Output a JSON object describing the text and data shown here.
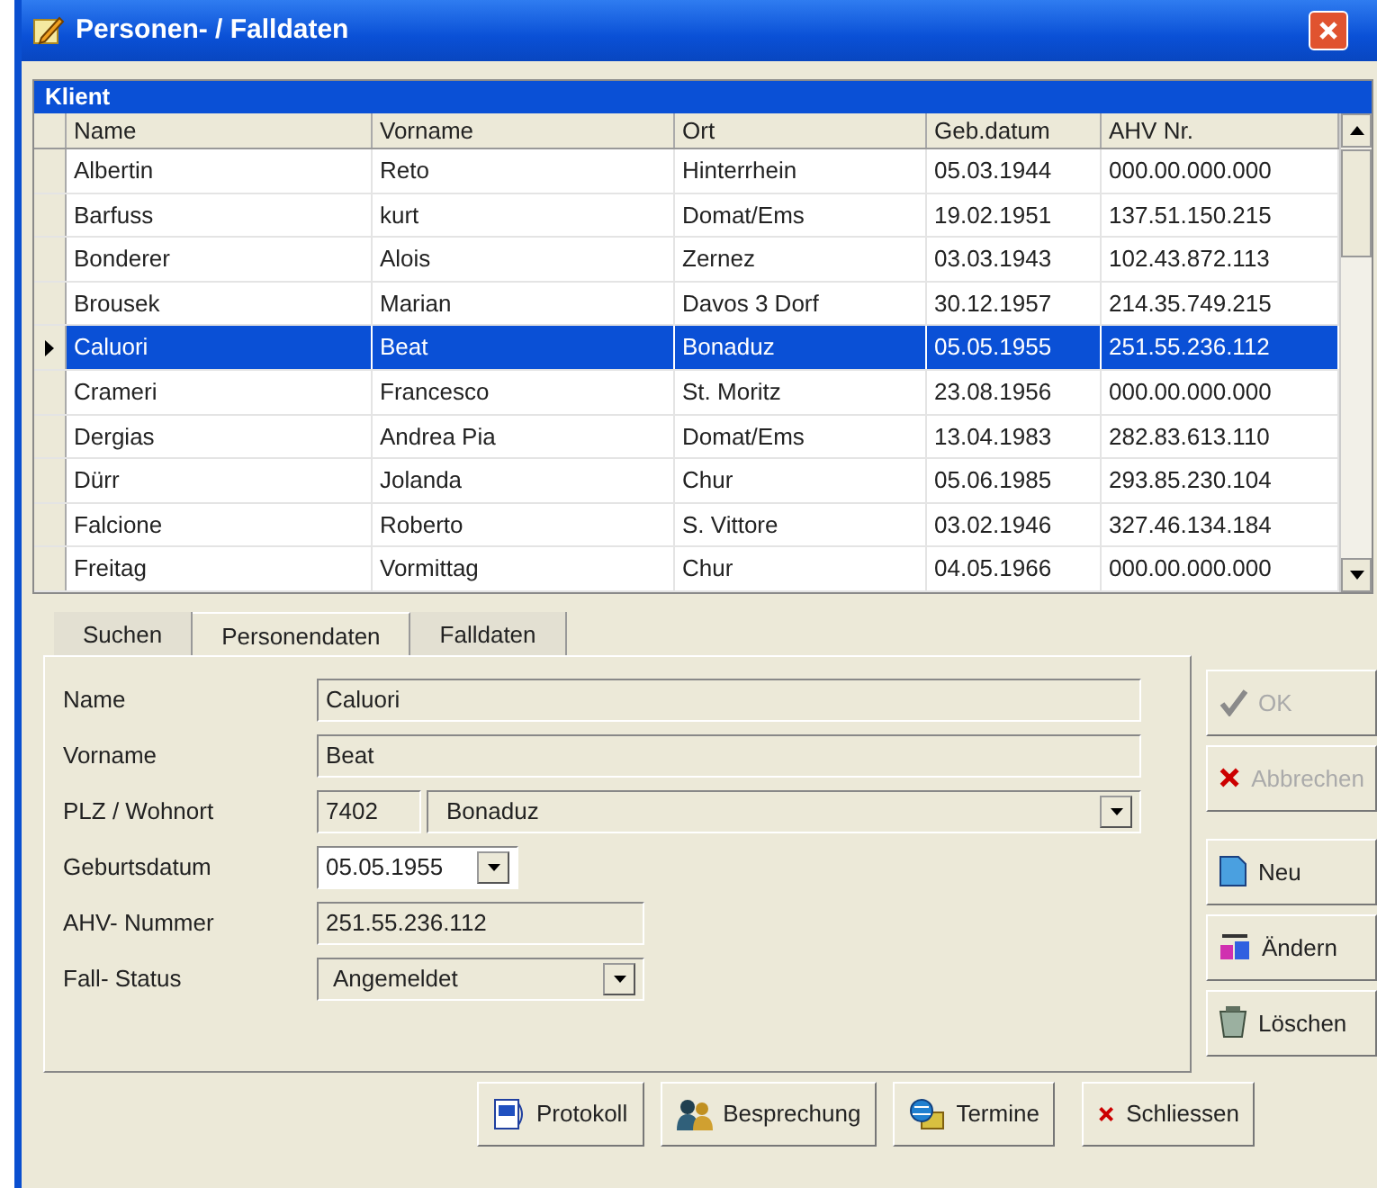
{
  "window": {
    "title": "Personen- / Falldaten"
  },
  "grid": {
    "title": "Klient",
    "columns": [
      "Name",
      "Vorname",
      "Ort",
      "Geb.datum",
      "AHV Nr."
    ],
    "rows": [
      {
        "cells": [
          "Albertin",
          "Reto",
          "Hinterrhein",
          "05.03.1944",
          "000.00.000.000"
        ],
        "selected": false
      },
      {
        "cells": [
          "Barfuss",
          "kurt",
          "Domat/Ems",
          "19.02.1951",
          "137.51.150.215"
        ],
        "selected": false
      },
      {
        "cells": [
          "Bonderer",
          "Alois",
          "Zernez",
          "03.03.1943",
          "102.43.872.113"
        ],
        "selected": false
      },
      {
        "cells": [
          "Brousek",
          "Marian",
          "Davos 3 Dorf",
          "30.12.1957",
          "214.35.749.215"
        ],
        "selected": false
      },
      {
        "cells": [
          "Caluori",
          "Beat",
          "Bonaduz",
          "05.05.1955",
          "251.55.236.112"
        ],
        "selected": true
      },
      {
        "cells": [
          "Crameri",
          "Francesco",
          "St. Moritz",
          "23.08.1956",
          "000.00.000.000"
        ],
        "selected": false
      },
      {
        "cells": [
          "Dergias",
          "Andrea Pia",
          "Domat/Ems",
          "13.04.1983",
          "282.83.613.110"
        ],
        "selected": false
      },
      {
        "cells": [
          "Dürr",
          "Jolanda",
          "Chur",
          "05.06.1985",
          "293.85.230.104"
        ],
        "selected": false
      },
      {
        "cells": [
          "Falcione",
          "Roberto",
          "S. Vittore",
          "03.02.1946",
          "327.46.134.184"
        ],
        "selected": false
      },
      {
        "cells": [
          "Freitag",
          "Vormittag",
          "Chur",
          "04.05.1966",
          "000.00.000.000"
        ],
        "selected": false
      }
    ]
  },
  "tabs": [
    {
      "label": "Suchen",
      "selected": false
    },
    {
      "label": "Personendaten",
      "selected": true
    },
    {
      "label": "Falldaten",
      "selected": false
    }
  ],
  "form": {
    "fields": [
      {
        "label": "Name",
        "kind": "text",
        "value": "Caluori"
      },
      {
        "label": "Vorname",
        "kind": "text",
        "value": "Beat"
      },
      {
        "label": "PLZ / Wohnort",
        "kind": "plz",
        "value": "7402",
        "city": "Bonaduz"
      },
      {
        "label": "Geburtsdatum",
        "kind": "date",
        "value": "05.05.1955"
      },
      {
        "label": "AHV- Nummer",
        "kind": "short",
        "value": "251.55.236.112"
      },
      {
        "label": "Fall- Status",
        "kind": "select",
        "value": "Angemeldet"
      }
    ]
  },
  "side_buttons": [
    {
      "label": "OK",
      "kind": "check",
      "disabled": true
    },
    {
      "label": "Abbrechen",
      "kind": "cross",
      "disabled": true
    },
    {
      "label": "Neu",
      "kind": "new",
      "disabled": false
    },
    {
      "label": "Ändern",
      "kind": "edit",
      "disabled": false
    },
    {
      "label": "Löschen",
      "kind": "trash",
      "disabled": false
    }
  ],
  "bottom_buttons": [
    {
      "label": "Protokoll",
      "kind": "doc"
    },
    {
      "label": "Besprechung",
      "kind": "people"
    },
    {
      "label": "Termine",
      "kind": "globe"
    },
    {
      "label": "Schliessen",
      "kind": "cross"
    }
  ]
}
